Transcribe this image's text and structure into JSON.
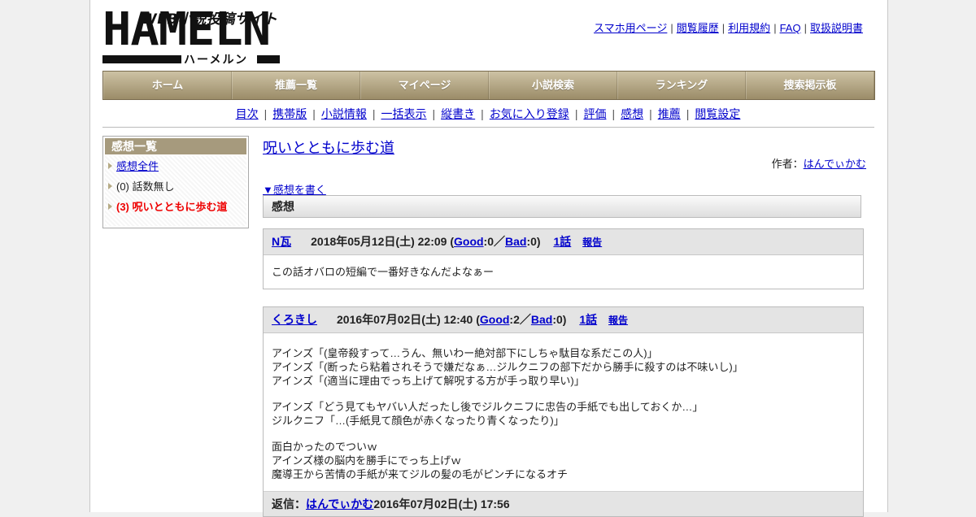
{
  "logo": {
    "tagline": "WEB小説投稿サイト",
    "wordmark": "HAMELN",
    "kana": "ハーメルン"
  },
  "top_links": [
    "スマホ用ページ",
    "閲覧履歴",
    "利用規約",
    "FAQ",
    "取扱説明書"
  ],
  "main_nav": [
    "ホーム",
    "推薦一覧",
    "マイページ",
    "小説検索",
    "ランキング",
    "捜索掲示板"
  ],
  "sub_nav": [
    "目次",
    "携帯版",
    "小説情報",
    "一括表示",
    "縦書き",
    "お気に入り登録",
    "評価",
    "感想",
    "推薦",
    "閲覧設定"
  ],
  "sidebar": {
    "title": "感想一覧",
    "items": [
      {
        "label": "感想全件"
      },
      {
        "label": "(0) 話数無し"
      },
      {
        "label": "(3) 呪いとともに歩む道"
      }
    ]
  },
  "novel": {
    "title": "呪いとともに歩む道",
    "author_label": "作者：",
    "author": "はんでぃかむ",
    "write_link": "▼感想を書く",
    "section": "感想"
  },
  "reviews": [
    {
      "user": "N瓦",
      "date": "2018年05月12日(土) 22:09",
      "open": "(",
      "good": "Good",
      "good_count": ":0／",
      "bad": "Bad",
      "bad_count": ":0)",
      "episode": "1話",
      "report": "報告",
      "paragraphs": [
        [
          "この話オバロの短編で一番好きなんだよなぁー"
        ]
      ]
    },
    {
      "user": "くろきし",
      "date": "2016年07月02日(土) 12:40",
      "open": "(",
      "good": "Good",
      "good_count": ":2／",
      "bad": "Bad",
      "bad_count": ":0)",
      "episode": "1話",
      "report": "報告",
      "paragraphs": [
        [
          "アインズ「(皇帝殺すって…うん、無いわー絶対部下にしちゃ駄目な系だこの人)」",
          "アインズ「(断ったら粘着されそうで嫌だなぁ…ジルクニフの部下だから勝手に殺すのは不味いし)」",
          "アインズ「(適当に理由でっち上げて解呪する方が手っ取り早い)」"
        ],
        [
          "アインズ「どう見てもヤバい人だったし後でジルクニフに忠告の手紙でも出しておくか…」",
          "ジルクニフ「…(手紙見て顔色が赤くなったり青くなったり)」"
        ],
        [
          "面白かったのでついｗ",
          "アインズ様の脳内を勝手にでっち上げｗ",
          "魔導王から苦情の手紙が来てジルの髪の毛がピンチになるオチ"
        ]
      ],
      "reply": {
        "label": "返信：",
        "user": "はんでぃかむ",
        "date": "2016年07月02日(土) 17:56"
      }
    }
  ]
}
